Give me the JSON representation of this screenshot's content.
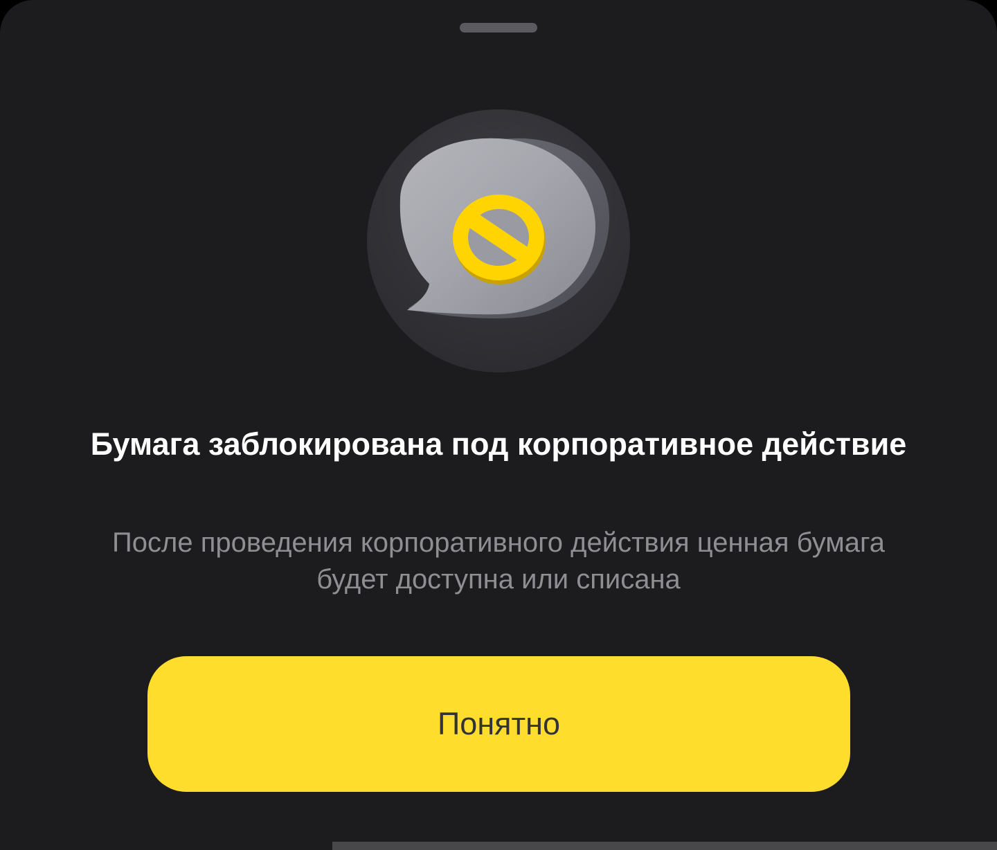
{
  "sheet": {
    "handle_icon": "drag-handle",
    "illustration_icon": "chat-bubble-blocked-icon",
    "title": "Бумага заблокирована под корпоративное действие",
    "subtitle": "После проведения корпоративного действия ценная бумага будет доступна или списана",
    "button_label": "Понятно"
  },
  "colors": {
    "background": "#1c1c1e",
    "accent_yellow": "#ffdd2d",
    "title_text": "#ffffff",
    "subtitle_text": "#8e8e93",
    "button_text": "#333333"
  }
}
